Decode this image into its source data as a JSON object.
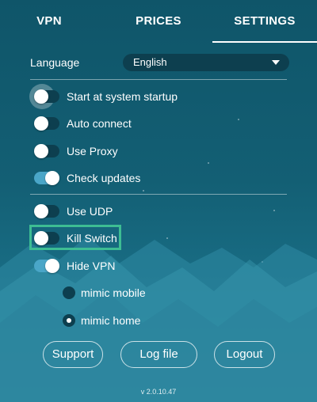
{
  "tabs": [
    {
      "label": "VPN"
    },
    {
      "label": "PRICES"
    },
    {
      "label": "SETTINGS",
      "active": true
    }
  ],
  "language": {
    "label": "Language",
    "selected": "English"
  },
  "options": {
    "startup": {
      "label": "Start at system startup",
      "on": false
    },
    "auto_connect": {
      "label": "Auto connect",
      "on": false
    },
    "use_proxy": {
      "label": "Use Proxy",
      "on": false
    },
    "check_updates": {
      "label": "Check updates",
      "on": true
    },
    "use_udp": {
      "label": "Use UDP",
      "on": false
    },
    "kill_switch": {
      "label": "Kill Switch",
      "on": false
    },
    "hide_vpn": {
      "label": "Hide VPN",
      "on": true
    }
  },
  "mimic": {
    "mobile": {
      "label": "mimic mobile",
      "checked": false
    },
    "home": {
      "label": "mimic home",
      "checked": true
    }
  },
  "buttons": {
    "support": "Support",
    "log_file": "Log file",
    "logout": "Logout"
  },
  "version": "v 2.0.10.47",
  "colors": {
    "background": "#135f74",
    "toggle_on": "#4aa6c8",
    "toggle_off": "#0d3f4f",
    "highlight": "#3dbd93"
  }
}
